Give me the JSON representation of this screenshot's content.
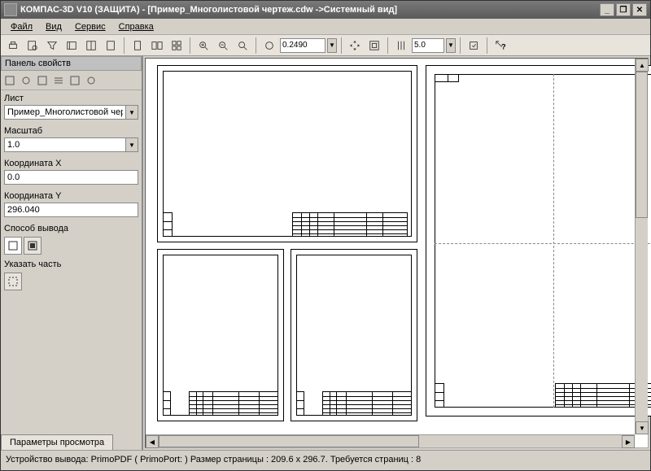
{
  "title": "КОМПАС-3D V10 (ЗАЩИТА) - [Пример_Многолистовой чертеж.cdw ->Системный вид]",
  "menu": {
    "file": "Файл",
    "view": "Вид",
    "service": "Сервис",
    "help": "Справка"
  },
  "toolbar": {
    "zoom": "0.2490",
    "step": "5.0"
  },
  "panel": {
    "title": "Панель свойств",
    "sheet_label": "Лист",
    "sheet_value": "Пример_Многолистовой чертеж",
    "scale_label": "Масштаб",
    "scale_value": "1.0",
    "x_label": "Координата X",
    "x_value": "0.0",
    "y_label": "Координата Y",
    "y_value": "296.040",
    "output_label": "Способ вывода",
    "specify_label": "Указать часть",
    "tab": "Параметры просмотра"
  },
  "status": "Устройство вывода: PrimoPDF ( PrimoPort: )  Размер страницы : 209.6 x 296.7.  Требуется страниц : 8"
}
